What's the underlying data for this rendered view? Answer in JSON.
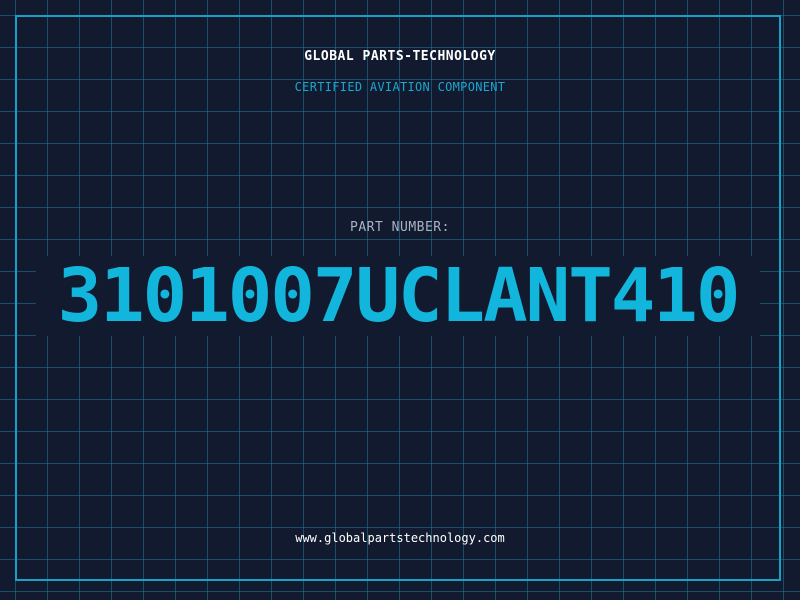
{
  "header": {
    "company": "GLOBAL PARTS-TECHNOLOGY",
    "subtitle": "CERTIFIED AVIATION COMPONENT"
  },
  "part": {
    "label": "PART NUMBER:",
    "number": "3101007UCLANT410"
  },
  "footer": {
    "website": "www.globalpartstechnology.com"
  },
  "colors": {
    "background": "#111a2e",
    "grid": "#22789a",
    "accent": "#12b6dc",
    "frame": "#19a0c4",
    "text_primary": "#ffffff",
    "text_muted": "#a9b4c2"
  }
}
